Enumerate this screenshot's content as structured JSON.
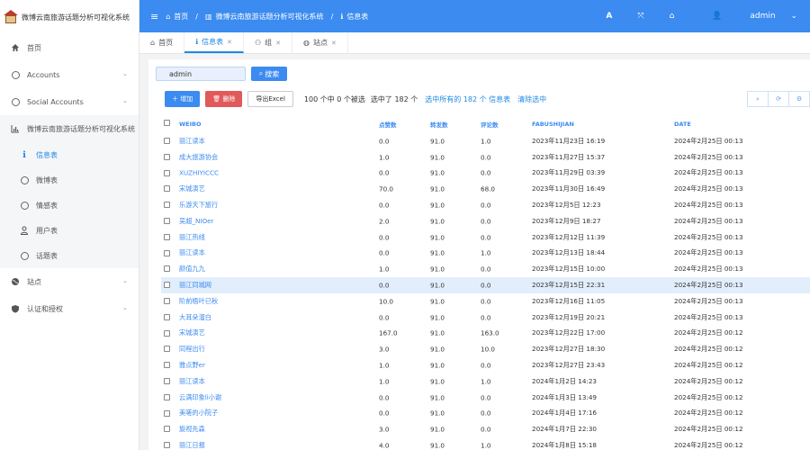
{
  "app": {
    "title": "微博云南旅游话题分析可视化系统"
  },
  "sidebar": {
    "items": [
      {
        "label": "首页",
        "icon": "home-icon"
      },
      {
        "label": "Accounts",
        "icon": "circle-icon"
      },
      {
        "label": "Social Accounts",
        "icon": "circle-icon"
      },
      {
        "label": "微博云南旅游话题分析可视化系统",
        "icon": "bar-chart-icon"
      },
      {
        "label": "信息表",
        "icon": "info-icon"
      },
      {
        "label": "微博表",
        "icon": "circle-icon"
      },
      {
        "label": "情感表",
        "icon": "circle-icon"
      },
      {
        "label": "用户表",
        "icon": "user-icon"
      },
      {
        "label": "话题表",
        "icon": "circle-icon"
      },
      {
        "label": "站点",
        "icon": "globe-icon"
      },
      {
        "label": "认证和授权",
        "icon": "shield-icon"
      }
    ]
  },
  "header": {
    "breadcrumb": [
      "首页",
      "微博云南旅游话题分析可视化系统",
      "信息表"
    ],
    "user": "admin"
  },
  "tabs": [
    {
      "label": "首页"
    },
    {
      "label": "信息表"
    },
    {
      "label": "组"
    },
    {
      "label": "站点"
    }
  ],
  "search": {
    "value": "admin",
    "button": "搜索"
  },
  "toolbar": {
    "add": "增加",
    "delete": "删除",
    "export": "导出Excel",
    "selected_count": "100 个中 0 个被选",
    "selected_total": "选中了 182 个",
    "select_all": "选中所有的 182 个 信息表",
    "clear": "清除选中"
  },
  "table": {
    "columns": [
      "WEIBO",
      "点赞数",
      "转发数",
      "评论数",
      "FABUSHIJIAN",
      "DATE"
    ],
    "rows": [
      [
        "丽江读本",
        "0.0",
        "91.0",
        "1.0",
        "2023年11月23日 16:19",
        "2024年2月25日 00:13"
      ],
      [
        "成大旅游协会",
        "1.0",
        "91.0",
        "0.0",
        "2023年11月27日 15:37",
        "2024年2月25日 00:13"
      ],
      [
        "XUZHIYICCC",
        "0.0",
        "91.0",
        "0.0",
        "2023年11月29日 03:39",
        "2024年2月25日 00:13"
      ],
      [
        "宋城演艺",
        "70.0",
        "91.0",
        "68.0",
        "2023年11月30日 16:49",
        "2024年2月25日 00:13"
      ],
      [
        "乐游天下旅行",
        "0.0",
        "91.0",
        "0.0",
        "2023年12月5日 12:23",
        "2024年2月25日 00:13"
      ],
      [
        "吴超_NIOer",
        "2.0",
        "91.0",
        "0.0",
        "2023年12月9日 18:27",
        "2024年2月25日 00:13"
      ],
      [
        "丽江热线",
        "0.0",
        "91.0",
        "0.0",
        "2023年12月12日 11:39",
        "2024年2月25日 00:13"
      ],
      [
        "丽江读本",
        "0.0",
        "91.0",
        "1.0",
        "2023年12月13日 18:44",
        "2024年2月25日 00:13"
      ],
      [
        "颜值九九",
        "1.0",
        "91.0",
        "0.0",
        "2023年12月15日 10:00",
        "2024年2月25日 00:13"
      ],
      [
        "丽江同城网",
        "0.0",
        "91.0",
        "0.0",
        "2023年12月15日 22:31",
        "2024年2月25日 00:13"
      ],
      [
        "阶前梧叶已秋",
        "10.0",
        "91.0",
        "0.0",
        "2023年12月16日 11:05",
        "2024年2月25日 00:13"
      ],
      [
        "大耳朵溜白",
        "0.0",
        "91.0",
        "0.0",
        "2023年12月19日 20:21",
        "2024年2月25日 00:13"
      ],
      [
        "宋城演艺",
        "167.0",
        "91.0",
        "163.0",
        "2023年12月22日 17:00",
        "2024年2月25日 00:12"
      ],
      [
        "同程出行",
        "3.0",
        "91.0",
        "10.0",
        "2023年12月27日 18:30",
        "2024年2月25日 00:12"
      ],
      [
        "雅点野er",
        "1.0",
        "91.0",
        "0.0",
        "2023年12月27日 23:43",
        "2024年2月25日 00:12"
      ],
      [
        "丽江读本",
        "1.0",
        "91.0",
        "1.0",
        "2024年1月2日 14:23",
        "2024年2月25日 00:12"
      ],
      [
        "云满印象lì小谢",
        "0.0",
        "91.0",
        "0.0",
        "2024年1月3日 13:49",
        "2024年2月25日 00:12"
      ],
      [
        "美嗟的小院子",
        "0.0",
        "91.0",
        "0.0",
        "2024年1月4日 17:16",
        "2024年2月25日 00:12"
      ],
      [
        "旋视先森",
        "3.0",
        "91.0",
        "0.0",
        "2024年1月7日 22:30",
        "2024年2月25日 00:12"
      ],
      [
        "丽江日报",
        "4.0",
        "91.0",
        "1.0",
        "2024年1月8日 15:18",
        "2024年2月25日 00:12"
      ]
    ]
  },
  "colors": {
    "accent": "#3b8bf0",
    "danger": "#e15a5a",
    "highlight": "#e3eefc"
  }
}
